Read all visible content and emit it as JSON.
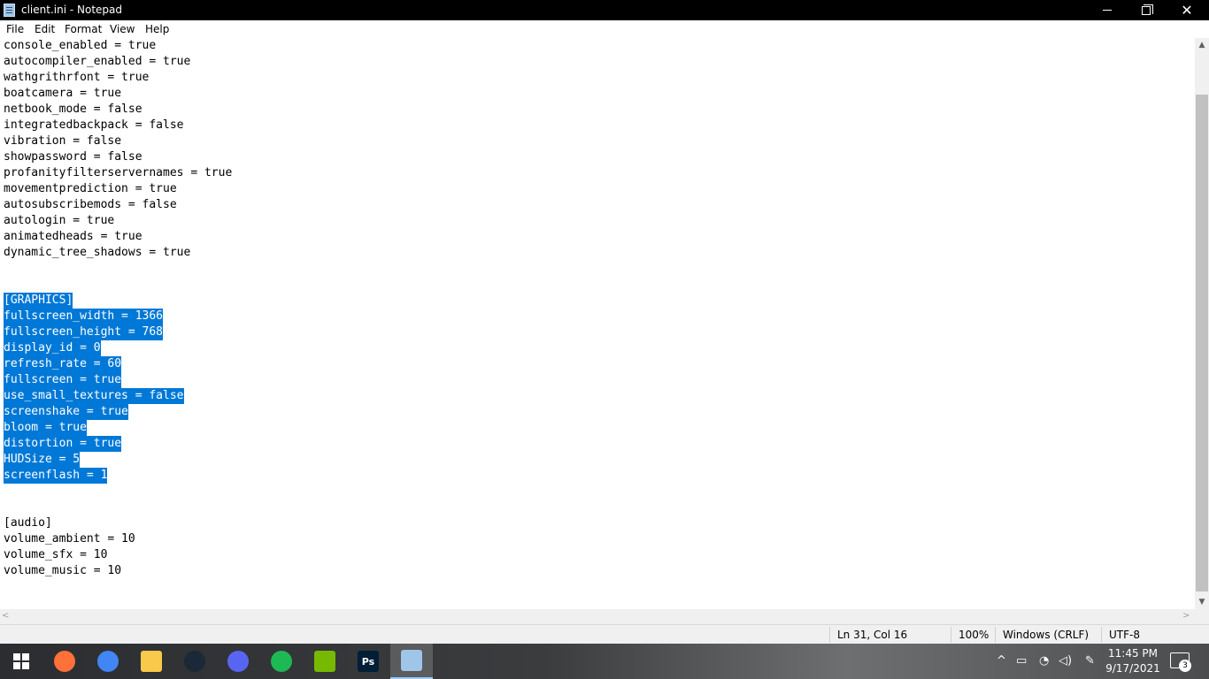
{
  "window": {
    "title": "client.ini - Notepad"
  },
  "menu": {
    "file": "File",
    "edit": "Edit",
    "format": "Format",
    "view": "View",
    "help": "Help"
  },
  "editor": {
    "lines": [
      {
        "text": "console_enabled = true",
        "selected": false
      },
      {
        "text": "autocompiler_enabled = true",
        "selected": false
      },
      {
        "text": "wathgrithrfont = true",
        "selected": false
      },
      {
        "text": "boatcamera = true",
        "selected": false
      },
      {
        "text": "netbook_mode = false",
        "selected": false
      },
      {
        "text": "integratedbackpack = false",
        "selected": false
      },
      {
        "text": "vibration = false",
        "selected": false
      },
      {
        "text": "showpassword = false",
        "selected": false
      },
      {
        "text": "profanityfilterservernames = true",
        "selected": false
      },
      {
        "text": "movementprediction = true",
        "selected": false
      },
      {
        "text": "autosubscribemods = false",
        "selected": false
      },
      {
        "text": "autologin = true",
        "selected": false
      },
      {
        "text": "animatedheads = true",
        "selected": false
      },
      {
        "text": "dynamic_tree_shadows = true",
        "selected": false
      },
      {
        "text": "",
        "selected": false
      },
      {
        "text": "",
        "selected": false
      },
      {
        "text": "[GRAPHICS]",
        "selected": true
      },
      {
        "text": "fullscreen_width = 1366",
        "selected": true
      },
      {
        "text": "fullscreen_height = 768",
        "selected": true
      },
      {
        "text": "display_id = 0",
        "selected": true
      },
      {
        "text": "refresh_rate = 60",
        "selected": true
      },
      {
        "text": "fullscreen = true",
        "selected": true
      },
      {
        "text": "use_small_textures = false",
        "selected": true
      },
      {
        "text": "screenshake = true",
        "selected": true
      },
      {
        "text": "bloom = true",
        "selected": true
      },
      {
        "text": "distortion = true",
        "selected": true
      },
      {
        "text": "HUDSize = 5",
        "selected": true
      },
      {
        "text": "screenflash = 1",
        "selected": true
      },
      {
        "text": "",
        "selected": false
      },
      {
        "text": "",
        "selected": false
      },
      {
        "text": "[audio]",
        "selected": false
      },
      {
        "text": "volume_ambient = 10",
        "selected": false
      },
      {
        "text": "volume_sfx = 10",
        "selected": false
      },
      {
        "text": "volume_music = 10",
        "selected": false
      }
    ]
  },
  "status": {
    "position": "Ln 31, Col 16",
    "zoom": "100%",
    "line_ending": "Windows (CRLF)",
    "encoding": "UTF-8"
  },
  "taskbar": {
    "apps": [
      {
        "name": "firefox-icon",
        "label": "",
        "color": "#ff7139"
      },
      {
        "name": "chrome-icon",
        "label": "",
        "color": "#4285f4"
      },
      {
        "name": "file-explorer-icon",
        "label": "",
        "color": "#f8c94a"
      },
      {
        "name": "steam-icon",
        "label": "",
        "color": "#1b2838"
      },
      {
        "name": "discord-icon",
        "label": "",
        "color": "#5865f2"
      },
      {
        "name": "spotify-icon",
        "label": "",
        "color": "#1db954"
      },
      {
        "name": "nvidia-icon",
        "label": "",
        "color": "#76b900"
      },
      {
        "name": "photoshop-icon",
        "label": "Ps",
        "color": "#001e36"
      },
      {
        "name": "notepad-icon",
        "label": "",
        "color": "#9fc5e8"
      }
    ],
    "clock": {
      "time": "11:45 PM",
      "date": "9/17/2021"
    },
    "notifications": "3"
  }
}
